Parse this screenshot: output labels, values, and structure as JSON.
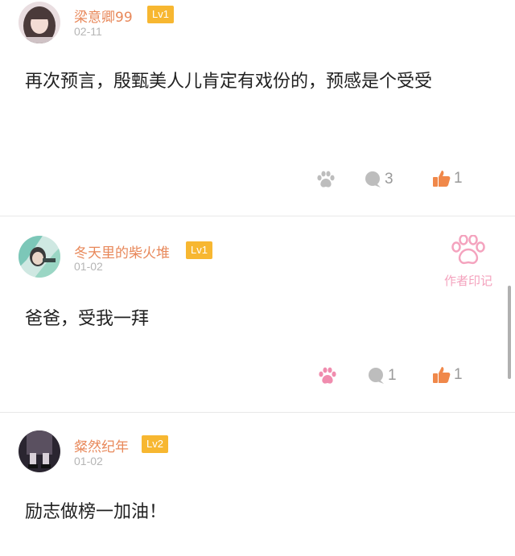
{
  "comments": [
    {
      "username": "梁意卿99",
      "level": "Lv1",
      "date": "02-11",
      "content": "再次预言，殷甄美人儿肯定有戏份的，预感是个受受",
      "paw_active": false,
      "reply_count": "3",
      "like_count": "1"
    },
    {
      "username": "冬天里的柴火堆",
      "level": "Lv1",
      "date": "01-02",
      "content": "爸爸，受我一拜",
      "paw_active": true,
      "reply_count": "1",
      "like_count": "1",
      "author_mark": "作者印记"
    },
    {
      "username": "粲然纪年",
      "level": "Lv2",
      "date": "01-02",
      "content": "励志做榜一加油！"
    }
  ],
  "colors": {
    "username": "#e8885a",
    "level_badge": "#f7b731",
    "paw_active": "#f08cae",
    "paw_inactive": "#bdbdbd",
    "like": "#f0884a",
    "author_mark": "#f4a3be"
  },
  "icons": {
    "paw": "paw-icon",
    "reply": "comment-bubble-icon",
    "like": "thumbs-up-icon"
  }
}
